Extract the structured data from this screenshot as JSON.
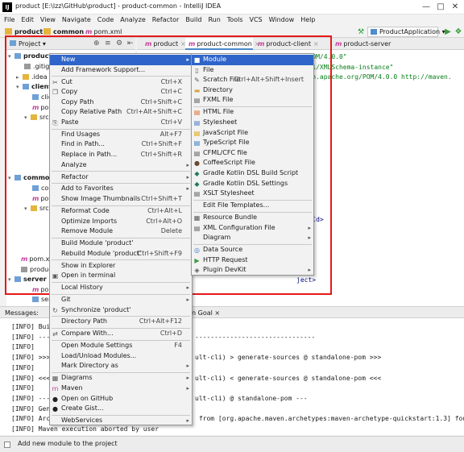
{
  "window": {
    "title": "product [E:\\lzz\\GitHub\\product] - product-common - IntelliJ IDEA",
    "app_icon": "IJ"
  },
  "menubar": [
    "File",
    "Edit",
    "View",
    "Navigate",
    "Code",
    "Analyze",
    "Refactor",
    "Build",
    "Run",
    "Tools",
    "VCS",
    "Window",
    "Help"
  ],
  "navbar": {
    "crumbs": [
      "product",
      "common",
      "pom.xml"
    ],
    "run_config": "ProductApplication"
  },
  "project_panel": {
    "title": "Project",
    "tree": [
      {
        "label": "product",
        "extra": "E:\\lzz\\GitHub\\product"
      },
      {
        "label": ".gitignore"
      },
      {
        "label": ".idea"
      },
      {
        "label": "client"
      },
      {
        "label": "client"
      },
      {
        "label": "pom.xml"
      },
      {
        "label": "src"
      },
      {
        "label": "common"
      },
      {
        "label": "common"
      },
      {
        "label": "pom.xml"
      },
      {
        "label": "src"
      },
      {
        "label": "pom.xml"
      },
      {
        "label": "product"
      },
      {
        "label": "server"
      },
      {
        "label": "pom.xml"
      },
      {
        "label": "server"
      }
    ]
  },
  "editor": {
    "tabs": [
      "product",
      "product-common",
      "product-client",
      "product-server"
    ],
    "active_tab": "product-common",
    "lines": [
      "rg/POM/4.0.0\"",
      "/2001/XMLSchema-instance\"",
      "maven.apache.org/POM/4.0.0 http://maven.",
      "",
      "",
      "",
      "",
      "",
      "",
      "",
      "",
      "tId>",
      "",
      "",
      "",
      "",
      "roupId>",
      "tId>",
      "",
      "",
      "",
      "",
      "ject>"
    ]
  },
  "context_menu": {
    "items": [
      {
        "label": "New",
        "submenu": true,
        "selected": true
      },
      {
        "label": "Add Framework Support...",
        "sep_after": true
      },
      {
        "label": "Cut",
        "shortcut": "Ctrl+X",
        "icon": "cut-icon"
      },
      {
        "label": "Copy",
        "shortcut": "Ctrl+C",
        "icon": "copy-icon"
      },
      {
        "label": "Copy Path",
        "shortcut": "Ctrl+Shift+C"
      },
      {
        "label": "Copy Relative Path",
        "shortcut": "Ctrl+Alt+Shift+C"
      },
      {
        "label": "Paste",
        "shortcut": "Ctrl+V",
        "icon": "paste-icon",
        "sep_after": true
      },
      {
        "label": "Find Usages",
        "shortcut": "Alt+F7"
      },
      {
        "label": "Find in Path...",
        "shortcut": "Ctrl+Shift+F"
      },
      {
        "label": "Replace in Path...",
        "shortcut": "Ctrl+Shift+R"
      },
      {
        "label": "Analyze",
        "submenu": true,
        "sep_after": true
      },
      {
        "label": "Refactor",
        "submenu": true,
        "sep_after": true
      },
      {
        "label": "Add to Favorites",
        "submenu": true
      },
      {
        "label": "Show Image Thumbnails",
        "shortcut": "Ctrl+Shift+T",
        "sep_after": true
      },
      {
        "label": "Reformat Code",
        "shortcut": "Ctrl+Alt+L"
      },
      {
        "label": "Optimize Imports",
        "shortcut": "Ctrl+Alt+O"
      },
      {
        "label": "Remove Module",
        "shortcut": "Delete",
        "sep_after": true
      },
      {
        "label": "Build Module 'product'"
      },
      {
        "label": "Rebuild Module 'product'",
        "shortcut": "Ctrl+Shift+F9",
        "sep_after": true
      },
      {
        "label": "Show in Explorer"
      },
      {
        "label": "Open in terminal",
        "icon": "terminal-icon",
        "sep_after": true
      },
      {
        "label": "Local History",
        "submenu": true,
        "sep_after": true
      },
      {
        "label": "Git",
        "submenu": true
      },
      {
        "label": "Synchronize 'product'",
        "icon": "sync-icon",
        "sep_after": true
      },
      {
        "label": "Directory Path",
        "shortcut": "Ctrl+Alt+F12",
        "sep_after": true
      },
      {
        "label": "Compare With...",
        "shortcut": "Ctrl+D",
        "icon": "compare-icon",
        "sep_after": true
      },
      {
        "label": "Open Module Settings",
        "shortcut": "F4"
      },
      {
        "label": "Load/Unload Modules..."
      },
      {
        "label": "Mark Directory as",
        "submenu": true,
        "sep_after": true
      },
      {
        "label": "Diagrams",
        "submenu": true,
        "icon": "diagram-icon"
      },
      {
        "label": "Maven",
        "submenu": true,
        "icon": "maven-icon"
      },
      {
        "label": "Open on GitHub",
        "icon": "github-icon"
      },
      {
        "label": "Create Gist...",
        "icon": "github-icon",
        "sep_after": true
      },
      {
        "label": "WebServices",
        "submenu": true
      }
    ]
  },
  "new_submenu": {
    "items": [
      {
        "label": "Module",
        "selected": true,
        "icon": "module-icon"
      },
      {
        "label": "File",
        "icon": "file-icon"
      },
      {
        "label": "Scratch File",
        "shortcut": "Ctrl+Alt+Shift+Insert",
        "icon": "scratch-icon"
      },
      {
        "label": "Directory",
        "icon": "folder-icon"
      },
      {
        "label": "FXML File",
        "icon": "fxml-icon",
        "sep_after": true
      },
      {
        "label": "HTML File",
        "icon": "html-icon"
      },
      {
        "label": "Stylesheet",
        "icon": "css-icon"
      },
      {
        "label": "JavaScript File",
        "icon": "js-icon"
      },
      {
        "label": "TypeScript File",
        "icon": "ts-icon"
      },
      {
        "label": "CFML/CFC file",
        "icon": "cf-icon"
      },
      {
        "label": "CoffeeScript File",
        "icon": "coffee-icon"
      },
      {
        "label": "Gradle Kotlin DSL Build Script",
        "icon": "gradle-icon"
      },
      {
        "label": "Gradle Kotlin DSL Settings",
        "icon": "gradle-icon"
      },
      {
        "label": "XSLT Stylesheet",
        "icon": "xslt-icon",
        "sep_after": true
      },
      {
        "label": "Edit File Templates...",
        "sep_after": true
      },
      {
        "label": "Resource Bundle",
        "icon": "bundle-icon"
      },
      {
        "label": "XML Configuration File",
        "submenu": true,
        "icon": "xml-icon"
      },
      {
        "label": "Diagram",
        "submenu": true,
        "sep_after": true
      },
      {
        "label": "Data Source",
        "icon": "datasource-icon"
      },
      {
        "label": "HTTP Request",
        "icon": "http-icon"
      },
      {
        "label": "Plugin DevKit",
        "submenu": true,
        "icon": "plugin-icon"
      }
    ]
  },
  "messages": {
    "title": "Messages:",
    "tab_partial": "n Goal",
    "lines": [
      "[INFO] Buil",
      "[INFO] ----",
      "[INFO]",
      "[INFO] >>> m",
      "[INFO]",
      "[INFO] <<< m",
      "[INFO]",
      "[INFO] --- ",
      "[INFO] Gene",
      "[INFO] Arch",
      "[INFO] Maven execution aborted by user"
    ],
    "right_fragments": [
      "-------------------------------",
      "",
      "ult-cli) > generate-sources @ standalone-pom >>>",
      "",
      "ult-cli) < generate-sources @ standalone-pom <<<",
      "",
      "ult-cli) @ standalone-pom ---",
      "",
      " from [org.apache.maven.archetypes:maven-archetype-quickstart:1.3] found in cata"
    ]
  },
  "status": {
    "text": "Add new module to the project"
  },
  "colors": {
    "highlight_border": "#e51919",
    "menu_selection": "#2f65ca",
    "maven_file": "#c3409a"
  }
}
